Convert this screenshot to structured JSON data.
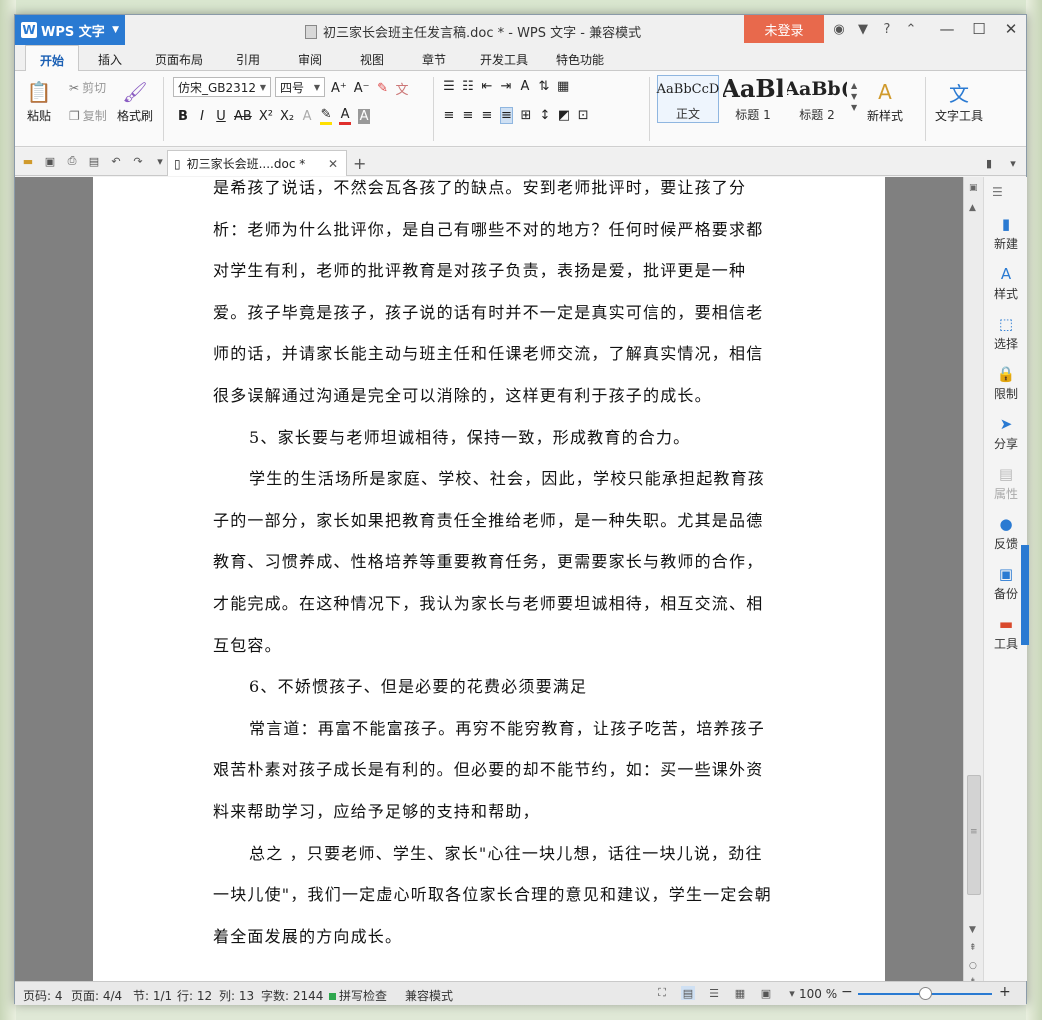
{
  "app": {
    "name": "WPS 文字",
    "window_title": "初三家长会班主任发言稿.doc * - WPS 文字 - 兼容模式",
    "login_label": "未登录"
  },
  "menu_tabs": [
    "开始",
    "插入",
    "页面布局",
    "引用",
    "审阅",
    "视图",
    "章节",
    "开发工具",
    "特色功能"
  ],
  "ribbon": {
    "paste": "粘贴",
    "cut": "剪切",
    "copy": "复制",
    "format_painter": "格式刷",
    "font_name": "仿宋_GB2312",
    "font_size": "四号",
    "styles": [
      {
        "sample": "AaBbCcD",
        "label": "正文"
      },
      {
        "sample": "AaBl",
        "label": "标题 1"
      },
      {
        "sample": "AaBb(",
        "label": "标题 2"
      }
    ],
    "new_style": "新样式",
    "text_tools": "文字工具"
  },
  "doc_tab": {
    "label": "初三家长会班....doc *"
  },
  "document": {
    "paragraphs": [
      {
        "indent": false,
        "text": "是希孩了说话，不然会瓦各孩了的缺点。安到老师批评时，要让孩了分析：老师为什么批评你，是自己有哪些不对的地方？任何时候严格要求都对学生有利，老师的批评教育是对孩子负责，表扬是爱，批评更是一种爱。孩子毕竟是孩子，孩子说的话有时并不一定是真实可信的，要相信老师的话，并请家长能主动与班主任和任课老师交流，了解真实情况，相信很多误解通过沟通是完全可以消除的，这样更有利于孩子的成长。"
      },
      {
        "indent": true,
        "text": "5、家长要与老师坦诚相待，保持一致，形成教育的合力。"
      },
      {
        "indent": true,
        "text": "学生的生活场所是家庭、学校、社会，因此，学校只能承担起教育孩子的一部分，家长如果把教育责任全推给老师，是一种失职。尤其是品德教育、习惯养成、性格培养等重要教育任务，更需要家长与教师的合作，才能完成。在这种情况下，我认为家长与老师要坦诚相待，相互交流、相互包容。"
      },
      {
        "indent": true,
        "text": "6、不娇惯孩子、但是必要的花费必须要满足"
      },
      {
        "indent": true,
        "text": "常言道：再富不能富孩子。再穷不能穷教育，让孩子吃苦，培养孩子艰苦朴素对孩子成长是有利的。但必要的却不能节约，如：买一些课外资料来帮助学习，应给予足够的支持和帮助，"
      },
      {
        "indent": true,
        "text": "总之 ，只要老师、学生、家长\"心往一块儿想，话往一块儿说，劲往一块儿使\"，我们一定虚心听取各位家长合理的意见和建议，学生一定会朝着全面发展的方向成长。"
      }
    ]
  },
  "task_pane": [
    {
      "label": "新建",
      "icon": "new-doc-icon",
      "glyph": "▮"
    },
    {
      "label": "样式",
      "icon": "style-icon",
      "glyph": "A"
    },
    {
      "label": "选择",
      "icon": "select-icon",
      "glyph": "⬚"
    },
    {
      "label": "限制",
      "icon": "restrict-icon",
      "glyph": "🔒"
    },
    {
      "label": "分享",
      "icon": "share-icon",
      "glyph": "➤"
    },
    {
      "label": "属性",
      "icon": "properties-icon",
      "glyph": "▤"
    },
    {
      "label": "反馈",
      "icon": "feedback-icon",
      "glyph": "●"
    },
    {
      "label": "备份",
      "icon": "backup-icon",
      "glyph": "▣"
    },
    {
      "label": "工具",
      "icon": "toolbox-icon",
      "glyph": "▬"
    }
  ],
  "status": {
    "page_no": "页码: 4",
    "pages": "页面: 4/4",
    "section": "节: 1/1",
    "row": "行: 12",
    "col": "列: 13",
    "words": "字数: 2144",
    "spell": "拼写检查",
    "mode": "兼容模式",
    "zoom": "100 %"
  },
  "colors": {
    "accent": "#2a7ad2",
    "login": "#e8694c"
  }
}
